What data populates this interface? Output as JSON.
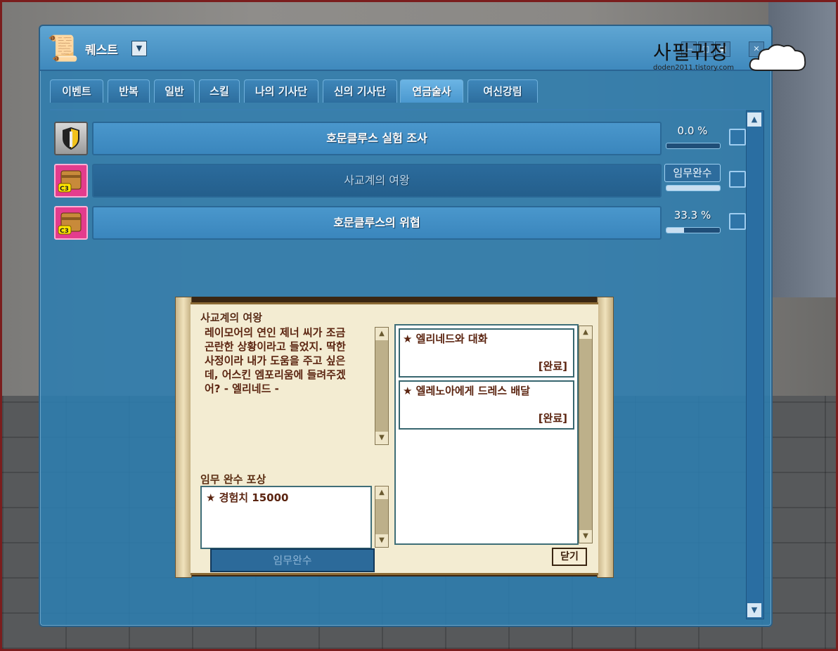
{
  "window": {
    "title": "퀘스트",
    "dropdown_icon": "chevron-down-icon",
    "control_icons": [
      "minimize-icon",
      "maximize-icon",
      "restore-icon",
      "close-icon"
    ]
  },
  "watermark": {
    "title": "사필귀정",
    "subtitle": "doden2011.tistory.com"
  },
  "tabs": [
    {
      "label": "이벤트",
      "active": false
    },
    {
      "label": "반복",
      "active": false
    },
    {
      "label": "일반",
      "active": false
    },
    {
      "label": "스킬",
      "active": false
    },
    {
      "label": "나의 기사단",
      "active": false
    },
    {
      "label": "신의 기사단",
      "active": false
    },
    {
      "label": "연금술사",
      "active": true
    },
    {
      "label": "여신강림",
      "active": false
    }
  ],
  "quests": [
    {
      "icon": "shield-sword-icon",
      "name": "호문클루스 실험 조사",
      "progress_text": "0.0 %",
      "progress": 0.0,
      "selected": false
    },
    {
      "icon": "c3-book-icon",
      "name": "사교계의 여왕",
      "status": "임무완수",
      "progress": 1.0,
      "selected": true
    },
    {
      "icon": "c3-book-icon",
      "name": "호문클루스의 위협",
      "progress_text": "33.3 %",
      "progress": 0.333,
      "selected": false
    }
  ],
  "detail": {
    "title": "사교계의 여왕",
    "description": "레이모어의 연인 제너 씨가 조금\n곤란한 상황이라고 들었지. 딱한\n사정이라 내가 도움을 주고 싶은\n데, 어스킨 엠포리움에 들려주겠\n어? - 엘리네드 -",
    "reward_title": "임무 완수 포상",
    "reward": "★ 경험치 15000",
    "complete_button": "임무완수",
    "close_button": "닫기",
    "objectives": [
      {
        "text": "★ 엘리네드와 대화",
        "status": "[완료]"
      },
      {
        "text": "★ 엘레노아에게 드레스 배달",
        "status": "[완료]"
      }
    ]
  }
}
